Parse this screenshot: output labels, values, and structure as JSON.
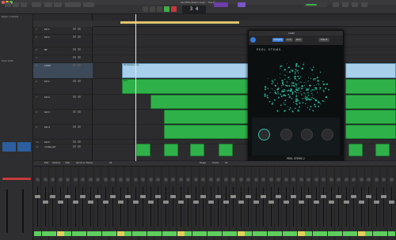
{
  "window": {
    "title": "00_PEEL-Stems Logic - Tracks"
  },
  "lcd": {
    "position": "3 4"
  },
  "inspector": {
    "region_label": "Region: 1 Sample",
    "track_label": "Track: LOOP"
  },
  "tracks": [
    {
      "num": "1",
      "name": "Kit 1"
    },
    {
      "num": "2",
      "name": "Kit 2"
    },
    {
      "num": "3",
      "name": "BF"
    },
    {
      "num": "4",
      "name": ""
    },
    {
      "num": "5",
      "name": "LOOP"
    },
    {
      "num": "6",
      "name": "Kit 1"
    },
    {
      "num": "7",
      "name": "Kit 2"
    },
    {
      "num": "8",
      "name": "Kit 3"
    },
    {
      "num": "9",
      "name": "Kit 4"
    },
    {
      "num": "10",
      "name": "Kit 5"
    },
    {
      "num": "11",
      "name": "ondas_kit"
    }
  ],
  "regions": {
    "loop_label": "00 Sample Loop",
    "green_label": "Kit 1"
  },
  "plugin": {
    "title": "LOOP",
    "logo": "PEEL STEMS",
    "footer": "PEEL STEMS 2",
    "preset": "Default",
    "tabs": [
      "Compare",
      "Undo",
      "Redo"
    ]
  },
  "mixer": {
    "tabs": [
      "Edit",
      "Options",
      "View",
      "Sends on Faders",
      "All",
      "Single",
      "Tracks",
      "All"
    ],
    "strip_count": 48
  }
}
